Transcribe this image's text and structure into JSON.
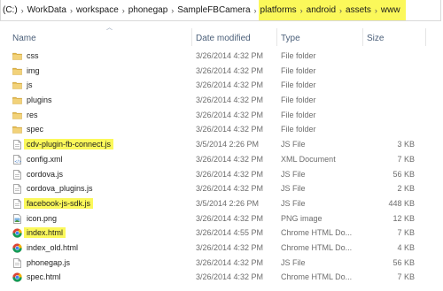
{
  "breadcrumb": {
    "root": "(C:)",
    "parts": [
      "WorkData",
      "workspace",
      "phonegap",
      "SampleFBCamera"
    ],
    "highlighted": [
      "platforms",
      "android",
      "assets",
      "www"
    ]
  },
  "columns": {
    "name": "Name",
    "date": "Date modified",
    "type": "Type",
    "size": "Size"
  },
  "files": [
    {
      "name": "css",
      "date": "3/26/2014 4:32 PM",
      "type": "File folder",
      "size": "",
      "icon": "folder-icon",
      "highlight": false
    },
    {
      "name": "img",
      "date": "3/26/2014 4:32 PM",
      "type": "File folder",
      "size": "",
      "icon": "folder-icon",
      "highlight": false
    },
    {
      "name": "js",
      "date": "3/26/2014 4:32 PM",
      "type": "File folder",
      "size": "",
      "icon": "folder-icon",
      "highlight": false
    },
    {
      "name": "plugins",
      "date": "3/26/2014 4:32 PM",
      "type": "File folder",
      "size": "",
      "icon": "folder-icon",
      "highlight": false
    },
    {
      "name": "res",
      "date": "3/26/2014 4:32 PM",
      "type": "File folder",
      "size": "",
      "icon": "folder-icon",
      "highlight": false
    },
    {
      "name": "spec",
      "date": "3/26/2014 4:32 PM",
      "type": "File folder",
      "size": "",
      "icon": "folder-icon",
      "highlight": false
    },
    {
      "name": "cdv-plugin-fb-connect.js",
      "date": "3/5/2014 2:26 PM",
      "type": "JS File",
      "size": "3 KB",
      "icon": "js-file-icon",
      "highlight": true
    },
    {
      "name": "config.xml",
      "date": "3/26/2014 4:32 PM",
      "type": "XML Document",
      "size": "7 KB",
      "icon": "xml-file-icon",
      "highlight": false
    },
    {
      "name": "cordova.js",
      "date": "3/26/2014 4:32 PM",
      "type": "JS File",
      "size": "56 KB",
      "icon": "js-file-icon",
      "highlight": false
    },
    {
      "name": "cordova_plugins.js",
      "date": "3/26/2014 4:32 PM",
      "type": "JS File",
      "size": "2 KB",
      "icon": "js-file-icon",
      "highlight": false
    },
    {
      "name": "facebook-js-sdk.js",
      "date": "3/5/2014 2:26 PM",
      "type": "JS File",
      "size": "448 KB",
      "icon": "js-file-icon",
      "highlight": true
    },
    {
      "name": "icon.png",
      "date": "3/26/2014 4:32 PM",
      "type": "PNG image",
      "size": "12 KB",
      "icon": "png-file-icon",
      "highlight": false
    },
    {
      "name": "index.html",
      "date": "3/26/2014 4:55 PM",
      "type": "Chrome HTML Do...",
      "size": "7 KB",
      "icon": "chrome-icon",
      "highlight": true
    },
    {
      "name": "index_old.html",
      "date": "3/26/2014 4:32 PM",
      "type": "Chrome HTML Do...",
      "size": "4 KB",
      "icon": "chrome-icon",
      "highlight": false
    },
    {
      "name": "phonegap.js",
      "date": "3/26/2014 4:32 PM",
      "type": "JS File",
      "size": "56 KB",
      "icon": "js-file-icon",
      "highlight": false
    },
    {
      "name": "spec.html",
      "date": "3/26/2014 4:32 PM",
      "type": "Chrome HTML Do...",
      "size": "7 KB",
      "icon": "chrome-icon",
      "highlight": false
    }
  ],
  "colors": {
    "highlight": "#fbf85a",
    "folder": "#e8c15a",
    "header_text": "#4c607a"
  }
}
